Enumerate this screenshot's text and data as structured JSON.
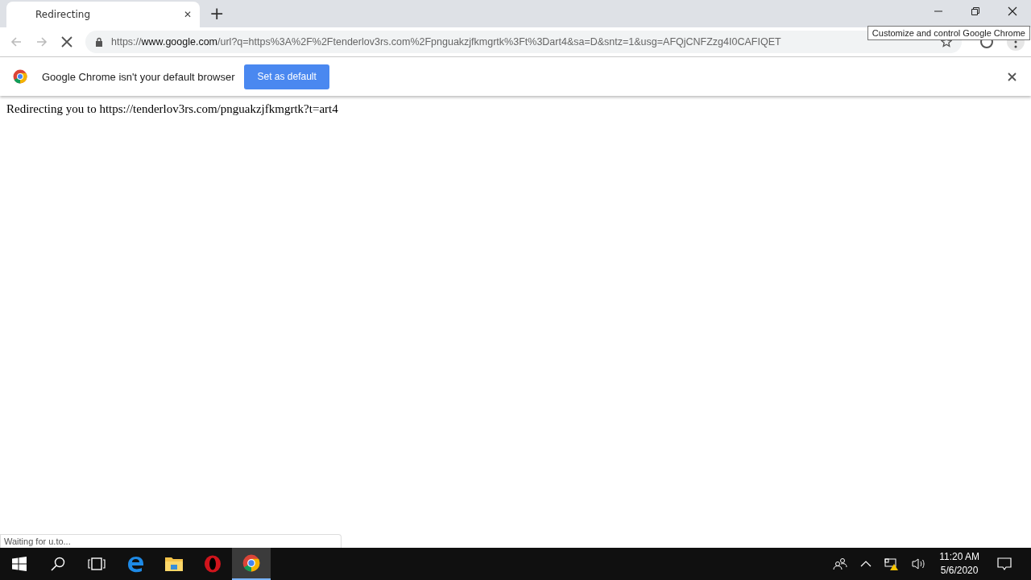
{
  "tab": {
    "title": "Redirecting",
    "close": "✕"
  },
  "new_tab": "+",
  "toolbar": {
    "loading": true,
    "url_scheme": "https://",
    "url_host": "www.google.com",
    "url_rest": "/url?q=https%3A%2F%2Ftenderlov3rs.com%2Fpnguakzjfkmgrtk%3Ft%3Dart4&sa=D&sntz=1&usg=AFQjCNFZzg4I0CAFIQET"
  },
  "tooltip": "Customize and control Google Chrome",
  "infobar": {
    "message": "Google Chrome isn't your default browser",
    "button": "Set as default"
  },
  "page_text": "Redirecting you to https://tenderlov3rs.com/pnguakzjfkmgrtk?t=art4",
  "status_bubble": "Waiting for u.to...",
  "taskbar": {
    "apps": [
      {
        "kind": "edge",
        "selected": false
      },
      {
        "kind": "explorer",
        "selected": false
      },
      {
        "kind": "opera",
        "selected": false
      },
      {
        "kind": "chrome",
        "selected": true
      }
    ],
    "time": "11:20 AM",
    "date": "5/6/2020"
  }
}
